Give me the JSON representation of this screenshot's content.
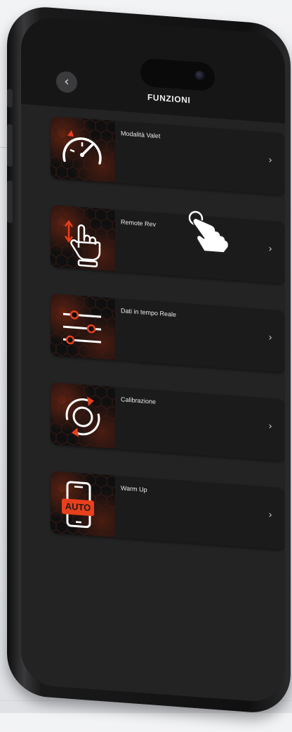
{
  "header": {
    "title": "FUNZIONI",
    "back_icon": "chevron-left-icon",
    "back_glyph": "‹"
  },
  "features": [
    {
      "label": "Modalità Valet",
      "icon": "speedometer-icon",
      "chevron": "›"
    },
    {
      "label": "Remote Rev",
      "icon": "touch-updown-icon",
      "chevron": "›"
    },
    {
      "label": "Dati in tempo Reale",
      "icon": "sliders-icon",
      "chevron": "›"
    },
    {
      "label": "Calibrazione",
      "icon": "calibration-cycle-icon",
      "chevron": "›"
    },
    {
      "label": "Warm Up",
      "icon": "phone-auto-icon",
      "chevron": "›",
      "badge": "AUTO"
    }
  ],
  "colors": {
    "accent": "#e8401c",
    "card_bg": "#1b1b1c",
    "screen_bg": "#232324",
    "text": "#ececec"
  }
}
